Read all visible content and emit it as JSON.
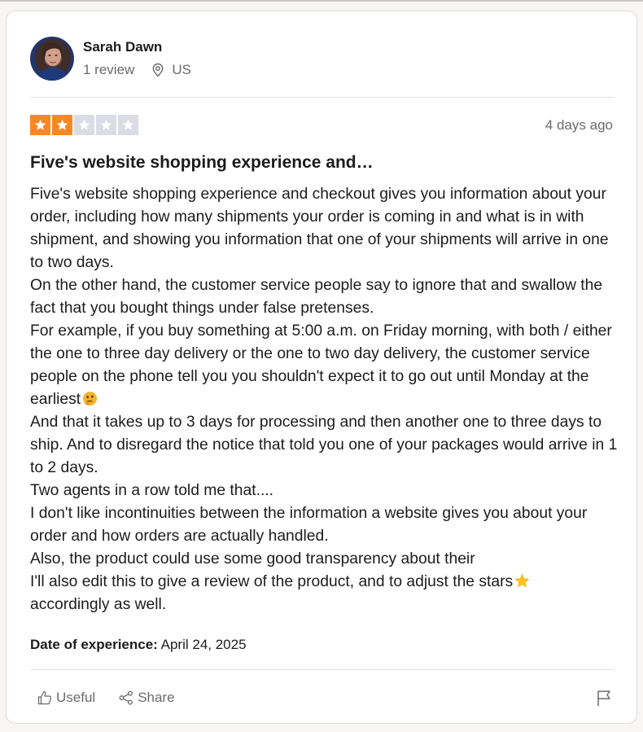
{
  "reviewer": {
    "name": "Sarah Dawn",
    "review_count": "1 review",
    "country": "US"
  },
  "review": {
    "rating": 2,
    "max_rating": 5,
    "date": "4 days ago",
    "title": "Five's website shopping experience and…",
    "paragraphs": [
      "Five's website shopping experience and checkout gives you information about your order, including how many shipments your order is coming in and what is in with shipment, and showing you information that one of your shipments will arrive in one to two days.",
      "On the other hand, the customer service people say to ignore that and swallow the fact that you bought things under false pretenses.",
      "For example, if you buy something at 5:00 a.m. on Friday morning, with both / either the one to three day delivery or the one to two day delivery, the customer service people on the phone tell you you shouldn't expect it to go out until Monday at the earliest",
      "And that it takes up to 3 days for processing and then another one to three days to ship. And to disregard the notice that told you one of your packages would arrive in 1 to 2 days.",
      "Two agents in a row told me that....",
      "I don't like incontinuities between the information a website gives you about your order and how orders are actually handled.",
      "Also, the product could use some good transparency about their",
      "I'll also edit this to give a review of the product, and to adjust the stars"
    ],
    "last_paragraph_end": "accordingly as well.",
    "date_of_experience_label": "Date of experience:",
    "date_of_experience": "April 24, 2025"
  },
  "actions": {
    "useful_label": "Useful",
    "share_label": "Share"
  },
  "colors": {
    "star_filled": "#ff8622",
    "star_empty": "#dcdce6"
  }
}
